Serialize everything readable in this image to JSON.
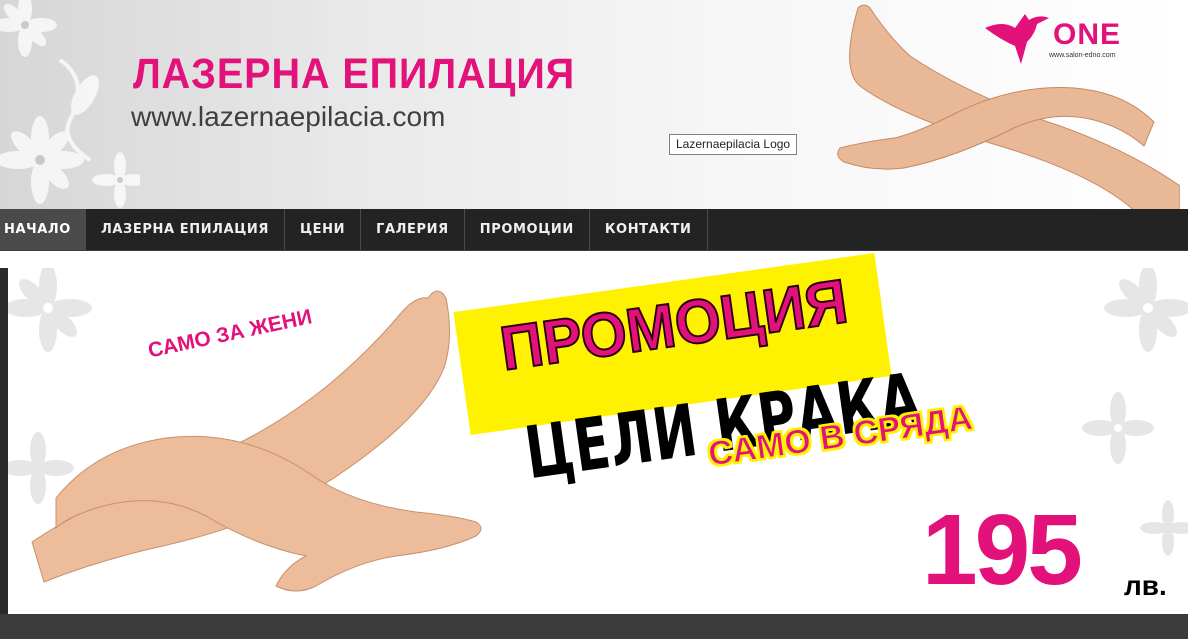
{
  "header": {
    "title": "ЛАЗЕРНА ЕПИЛАЦИЯ",
    "url": "www.lazernaepilacia.com",
    "logo_tooltip": "Lazernaepilacia Logo",
    "brand": "ONE",
    "brand_site": "www.salon-edno.com",
    "brand_icon": "hummingbird-icon"
  },
  "nav": {
    "items": [
      {
        "label": "НАЧАЛО",
        "active": true
      },
      {
        "label": "ЛАЗЕРНА ЕПИЛАЦИЯ",
        "active": false
      },
      {
        "label": "ЦЕНИ",
        "active": false
      },
      {
        "label": "ГАЛЕРИЯ",
        "active": false
      },
      {
        "label": "ПРОМОЦИИ",
        "active": false
      },
      {
        "label": "КОНТАКТИ",
        "active": false
      }
    ]
  },
  "banner": {
    "tagline": "САМО ЗА ЖЕНИ",
    "promo": "ПРОМОЦИЯ",
    "service": "ЦЕЛИ КРАКА",
    "day": "САМО В СРЯДА",
    "price": "195",
    "currency": "лв."
  },
  "colors": {
    "accent": "#e2127a",
    "highlight": "#fff200",
    "nav_bg": "#232323"
  }
}
